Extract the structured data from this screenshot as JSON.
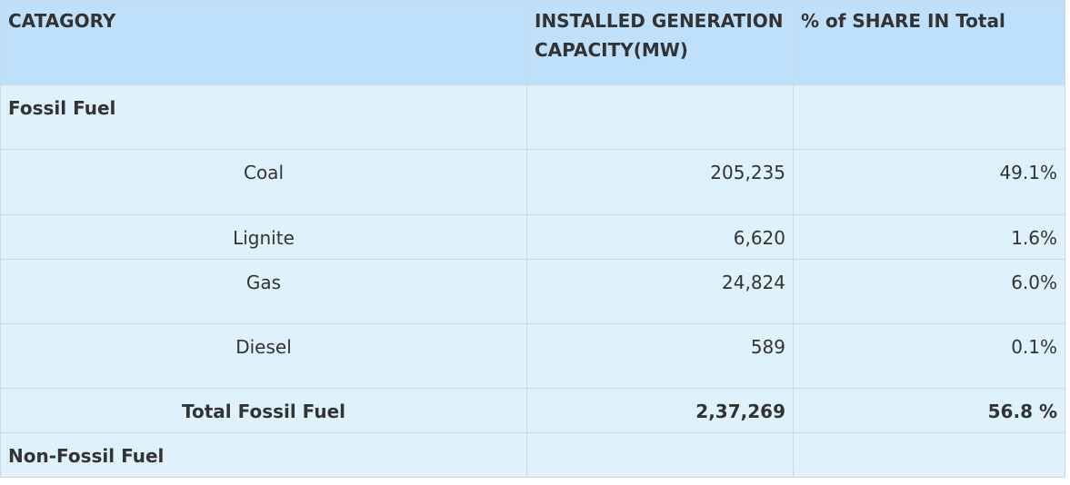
{
  "table": {
    "headers": {
      "category": "CATAGORY",
      "capacity_line1": "INSTALLED GENERATION",
      "capacity_line2": "CAPACITY(MW)",
      "share": "% of SHARE IN Total"
    },
    "fossil_section": "Fossil Fuel",
    "rows": [
      {
        "name": "Coal",
        "capacity": "205,235",
        "share": "49.1%"
      },
      {
        "name": "Lignite",
        "capacity": "6,620",
        "share": "1.6%"
      },
      {
        "name": "Gas",
        "capacity": "24,824",
        "share": "6.0%"
      },
      {
        "name": "Diesel",
        "capacity": "589",
        "share": "0.1%"
      }
    ],
    "total": {
      "name": "Total Fossil Fuel",
      "capacity": "2,37,269",
      "share": "56.8 %"
    },
    "non_fossil_section": "Non-Fossil Fuel"
  },
  "colors": {
    "header_bg": "#bfe0fb",
    "body_bg": "#dff2fb",
    "border": "#cfd8df",
    "text": "#333333"
  }
}
